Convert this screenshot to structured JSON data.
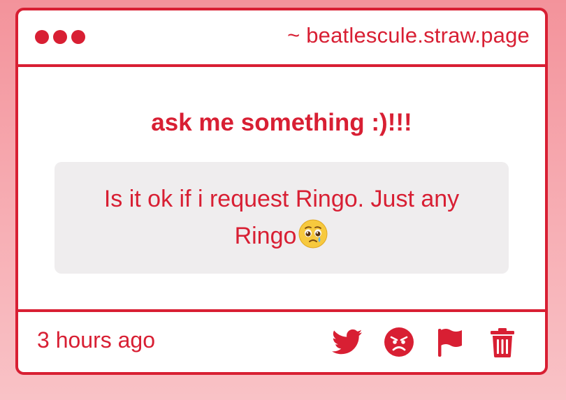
{
  "window": {
    "url": "~ beatlescule.straw.page"
  },
  "prompt": {
    "title": "ask me something :)!!!"
  },
  "message": {
    "text": "Is it ok if i request Ringo. Just any Ringo",
    "emoji": "pleading-face-tear-icon"
  },
  "footer": {
    "timestamp": "3 hours ago",
    "actions": [
      {
        "name": "twitter-icon"
      },
      {
        "name": "angry-face-icon"
      },
      {
        "name": "flag-icon"
      },
      {
        "name": "trash-icon"
      }
    ]
  },
  "colors": {
    "accent": "#d81f33",
    "card_background": "#ffffff",
    "message_background": "#efedee",
    "page_gradient_top": "#f3939b",
    "page_gradient_bottom": "#f9c2c6"
  }
}
